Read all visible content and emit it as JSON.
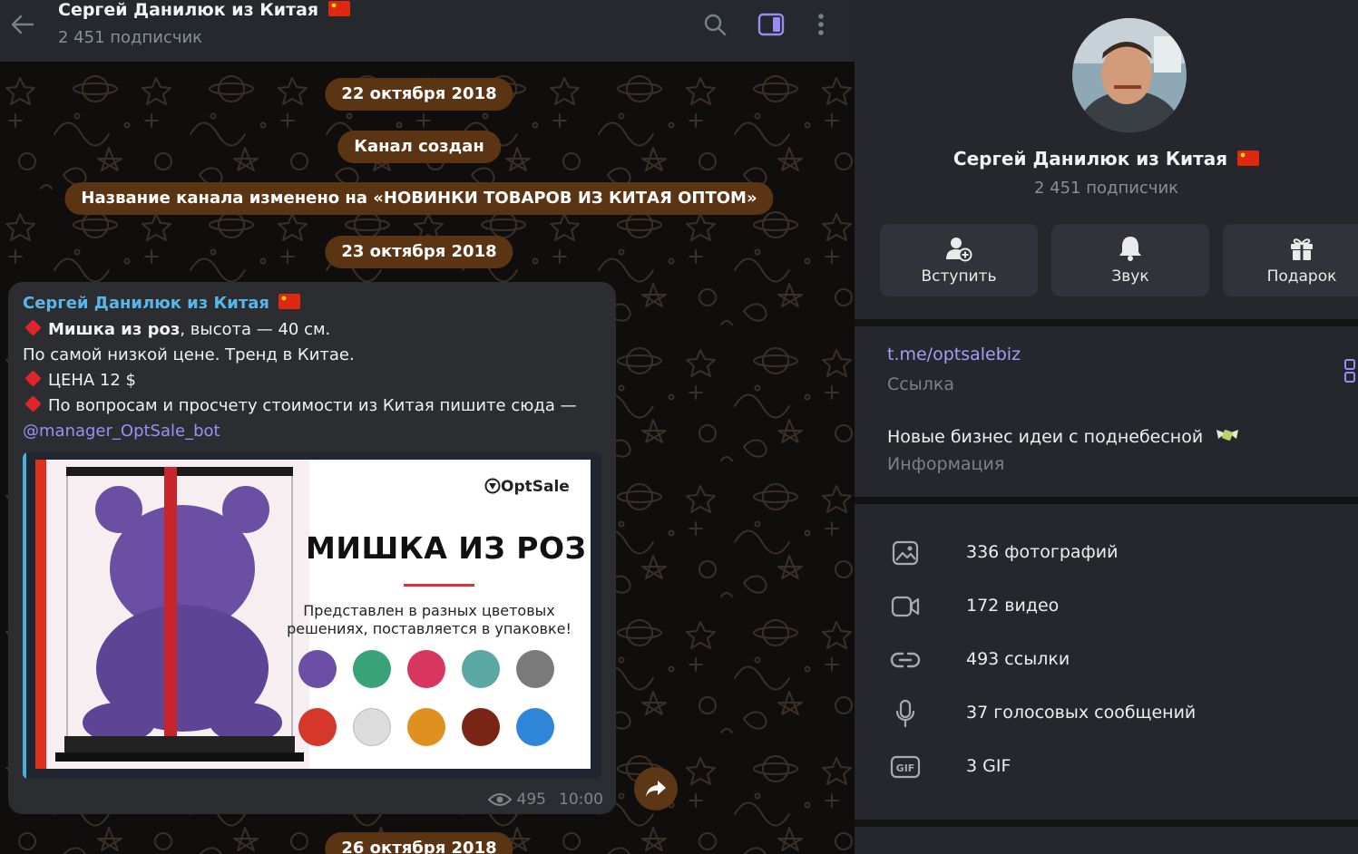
{
  "header": {
    "channel_name": "Сергей Данилюк из Китая",
    "subscribers": "2 451 подписчик"
  },
  "timeline": {
    "date1": "22 октября 2018",
    "created": "Канал создан",
    "renamed": "Название канала изменено на «НОВИНКИ ТОВАРОВ ИЗ КИТАЯ ОПТОМ»",
    "date2": "23 октября 2018",
    "date3": "26 октября 2018"
  },
  "message": {
    "author": "Сергей Данилюк из Китая",
    "line1_bold": "Мишка из роз",
    "line1_rest": ", высота — 40 см.",
    "line2": "По самой низкой цене. Тренд в Китае.",
    "line3": "ЦЕНА 12 $",
    "line4": "По вопросам и просчету стоимости из Китая пишите сюда —",
    "mention": "@manager_OptSale_bot",
    "views": "495",
    "time": "10:00",
    "preview": {
      "brand": "OptSale",
      "title": "МИШКА ИЗ РОЗ",
      "description": "Представлен в разных цветовых решениях, поставляется в упаковке!"
    }
  },
  "panel": {
    "title": "Сергей Данилюк из Китая",
    "subscribers": "2 451 подписчик",
    "actions": [
      {
        "label": "Вступить",
        "icon": "add-user-icon"
      },
      {
        "label": "Звук",
        "icon": "bell-icon"
      },
      {
        "label": "Подарок",
        "icon": "gift-icon"
      }
    ],
    "link": "t.me/optsalebiz",
    "link_caption": "Ссылка",
    "description": "Новые бизнес идеи с поднебесной",
    "description_caption": "Информация",
    "media": [
      {
        "label": "336 фотографий",
        "icon": "photo-icon"
      },
      {
        "label": "172 видео",
        "icon": "video-icon"
      },
      {
        "label": "493 ссылки",
        "icon": "link-icon"
      },
      {
        "label": "37 голосовых сообщений",
        "icon": "microphone-icon"
      },
      {
        "label": "3 GIF",
        "icon": "gif-icon"
      }
    ]
  },
  "colors": {
    "accent_link": "#a99af7",
    "author_blue": "#59b6e8",
    "service_pill": "#5b3414",
    "panel_bg": "#25272c"
  }
}
